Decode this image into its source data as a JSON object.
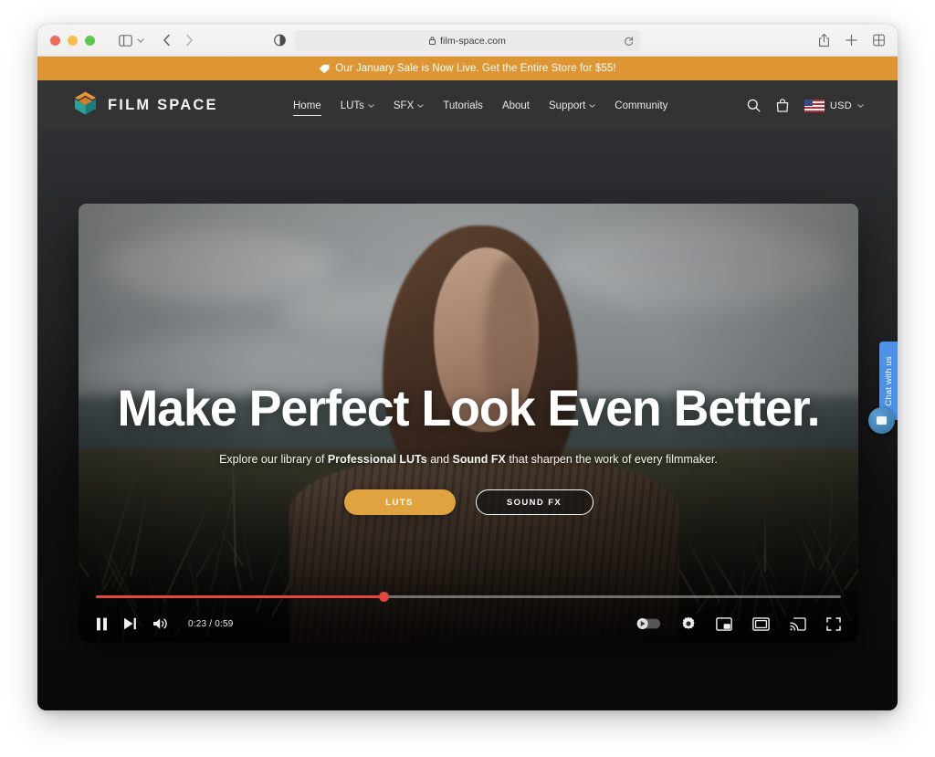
{
  "browser": {
    "url": "film-space.com",
    "lock_icon": "lock-icon",
    "reload_icon": "reload-icon",
    "traffic_lights": [
      "close-red",
      "minimize-yellow",
      "maximize-green"
    ],
    "toolbar_icons": [
      {
        "name": "sidebar-toggle-icon",
        "label": "Show Sidebar"
      },
      {
        "name": "sidebar-chevron-icon",
        "label": "⌄"
      },
      {
        "name": "nav-back-icon",
        "label": "Back"
      },
      {
        "name": "nav-forward-icon",
        "label": "Forward"
      },
      {
        "name": "reader-mode-icon",
        "label": "Reader"
      },
      {
        "name": "share-icon",
        "label": "Share"
      },
      {
        "name": "new-tab-icon",
        "label": "New Tab"
      },
      {
        "name": "tab-overview-icon",
        "label": "Tab Overview"
      }
    ]
  },
  "banner": {
    "icon": "price-tag-icon",
    "text": "Our January Sale is Now Live. Get the Entire Store for $55!",
    "background_color": "#dd9633",
    "text_color": "#ffffff"
  },
  "header": {
    "logo_text": "FILM SPACE",
    "logo_icon": "film-space-cube-logo",
    "logo_colors": {
      "top": "#e8933a",
      "bottom": "#2f9f9b"
    },
    "background_color": "#333334",
    "nav": [
      {
        "label": "Home",
        "has_dropdown": false,
        "active": true
      },
      {
        "label": "LUTs",
        "has_dropdown": true,
        "active": false
      },
      {
        "label": "SFX",
        "has_dropdown": true,
        "active": false
      },
      {
        "label": "Tutorials",
        "has_dropdown": false,
        "active": false
      },
      {
        "label": "About",
        "has_dropdown": false,
        "active": false
      },
      {
        "label": "Support",
        "has_dropdown": true,
        "active": false
      },
      {
        "label": "Community",
        "has_dropdown": false,
        "active": false
      }
    ],
    "search_icon": "search-icon",
    "cart_icon": "shopping-bag-icon",
    "currency": {
      "flag": "us-flag-icon",
      "label": "USD",
      "caret": "⌄"
    }
  },
  "hero": {
    "title": "Make Perfect Look Even Better.",
    "subtitle_parts": [
      {
        "text": "Explore our library of ",
        "bold": false
      },
      {
        "text": "Professional LUTs",
        "bold": true
      },
      {
        "text": " and ",
        "bold": false
      },
      {
        "text": "Sound FX",
        "bold": true
      },
      {
        "text": " that sharpen the work of every filmmaker.",
        "bold": false
      }
    ],
    "buttons": [
      {
        "label": "LUTS",
        "style": "filled",
        "color": "#e0a33f"
      },
      {
        "label": "SOUND FX",
        "style": "outline",
        "color": "#ffffff"
      }
    ]
  },
  "player": {
    "time_display": "0:23 / 0:59",
    "current_time": "0:23",
    "duration": "0:59",
    "progress_percent": 38.6,
    "progress_color": "#e3463a",
    "left_controls": [
      {
        "name": "pause-icon",
        "label": "Pause"
      },
      {
        "name": "next-track-icon",
        "label": "Next"
      },
      {
        "name": "volume-icon",
        "label": "Volume"
      }
    ],
    "right_controls": [
      {
        "name": "autoplay-toggle-icon",
        "label": "Autoplay"
      },
      {
        "name": "settings-gear-icon",
        "label": "Settings"
      },
      {
        "name": "miniplayer-icon",
        "label": "Miniplayer"
      },
      {
        "name": "theater-mode-icon",
        "label": "Theater mode"
      },
      {
        "name": "cast-icon",
        "label": "Cast"
      },
      {
        "name": "fullscreen-icon",
        "label": "Full screen"
      }
    ]
  },
  "chat_widget": {
    "tab_label": "Chat with us",
    "bubble_icon": "chat-bubble-icon",
    "accent_color": "#4e92e8"
  }
}
